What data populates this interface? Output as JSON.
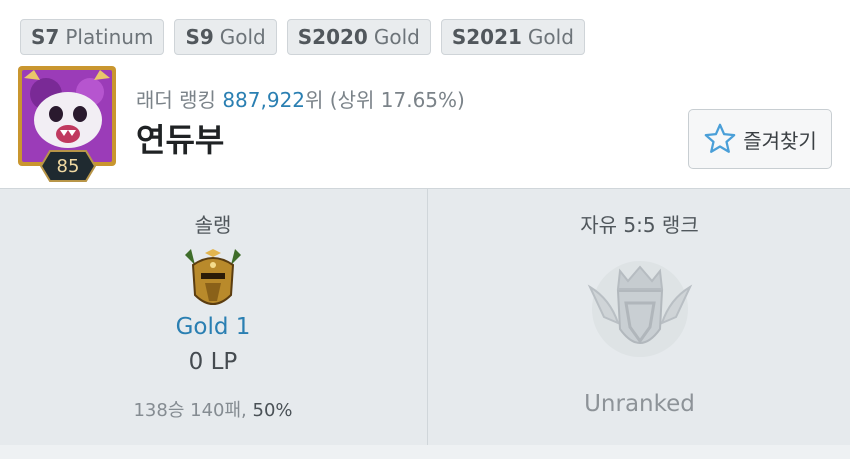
{
  "seasons": [
    {
      "season": "S7",
      "tier": "Platinum"
    },
    {
      "season": "S9",
      "tier": "Gold"
    },
    {
      "season": "S2020",
      "tier": "Gold"
    },
    {
      "season": "S2021",
      "tier": "Gold"
    }
  ],
  "profile": {
    "level": "85",
    "ladder_prefix": "래더 랭킹",
    "ladder_rank": "887,922",
    "ladder_suffix": "위 (상위 17.65%)",
    "summoner_name": "연듀부"
  },
  "favorite_button": {
    "label": "즐겨찾기",
    "icon": "star-icon"
  },
  "solo_rank": {
    "title": "솔랭",
    "tier": "Gold 1",
    "lp": "0 LP",
    "record": "138승 140패,",
    "win_rate": "50%",
    "emblem": "gold-emblem-icon"
  },
  "flex_rank": {
    "title": "자유 5:5 랭크",
    "status": "Unranked",
    "emblem": "unranked-emblem-icon"
  },
  "colors": {
    "accent_blue": "#2a7fb2",
    "panel_bg": "#e6eaed",
    "badge_bg": "#e9ecee"
  }
}
